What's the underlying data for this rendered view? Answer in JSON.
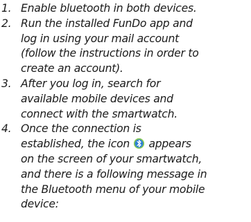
{
  "steps": [
    {
      "number": "1.",
      "lines": [
        "Enable bluetooth in both devices."
      ]
    },
    {
      "number": "2.",
      "lines": [
        "Run the installed FunDo app and",
        "log in using your mail account",
        "(follow the instructions in order to",
        "create an account)."
      ]
    },
    {
      "number": "3.",
      "lines": [
        "After you log in, search for",
        "available mobile devices and",
        "connect with the smartwatch."
      ]
    },
    {
      "number": "4.",
      "lines": [
        "Once the connection is",
        "established, the icon",
        "appears",
        "on the screen of your smartwatch,",
        "and there is a following message in",
        "the Bluetooth menu of your mobile",
        "device:"
      ]
    }
  ],
  "icons": {
    "inline_icon": "bluetooth-icon",
    "inline_icon_colors": {
      "fill": "#2d7fd2",
      "ring": "#8ed04a"
    }
  }
}
